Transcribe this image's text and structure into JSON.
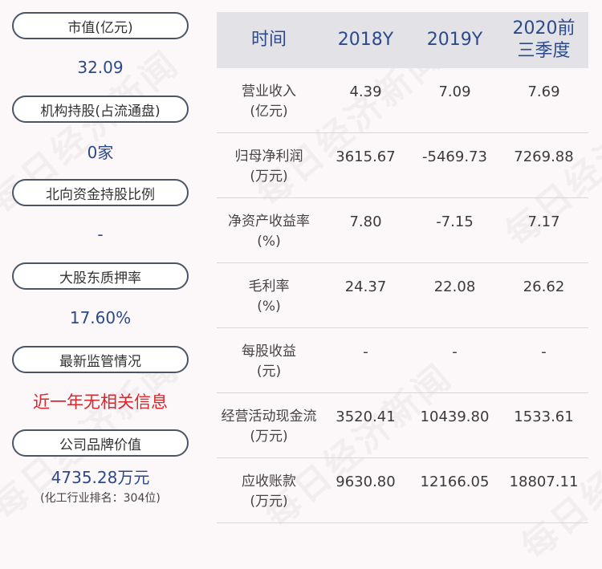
{
  "watermark": "每日经济新闻",
  "left_panel": [
    {
      "label": "市值(亿元)",
      "value": "32.09"
    },
    {
      "label": "机构持股(占流通盘)",
      "value": "0家"
    },
    {
      "label": "北向资金持股比例",
      "value": "-"
    },
    {
      "label": "大股东质押率",
      "value": "17.60%"
    },
    {
      "label": "最新监管情况",
      "value": "近一年无相关信息"
    },
    {
      "label": "公司品牌价值",
      "value": "4735.28万元",
      "sub": "(化工行业排名：304位)"
    }
  ],
  "table": {
    "headers": [
      "时间",
      "2018Y",
      "2019Y",
      "2020前三季度"
    ],
    "rows": [
      {
        "metric": "营业收入",
        "unit": "(亿元)",
        "values": [
          "4.39",
          "7.09",
          "7.69"
        ]
      },
      {
        "metric": "归母净利润",
        "unit": "(万元)",
        "values": [
          "3615.67",
          "-5469.73",
          "7269.88"
        ]
      },
      {
        "metric": "净资产收益率",
        "unit": "(%)",
        "values": [
          "7.80",
          "-7.15",
          "7.17"
        ]
      },
      {
        "metric": "毛利率",
        "unit": "(%)",
        "values": [
          "24.37",
          "22.08",
          "26.62"
        ]
      },
      {
        "metric": "每股收益",
        "unit": "(元)",
        "values": [
          "-",
          "-",
          "-"
        ]
      },
      {
        "metric": "经营活动现金流",
        "unit": "(万元)",
        "values": [
          "3520.41",
          "10439.80",
          "1533.61"
        ]
      },
      {
        "metric": "应收账款",
        "unit": "(万元)",
        "values": [
          "9630.80",
          "12166.05",
          "18807.11"
        ]
      }
    ]
  },
  "colors": {
    "accent": "#2c4a8a",
    "alert": "#d9272e",
    "header_bg": "#e3e3e7"
  }
}
